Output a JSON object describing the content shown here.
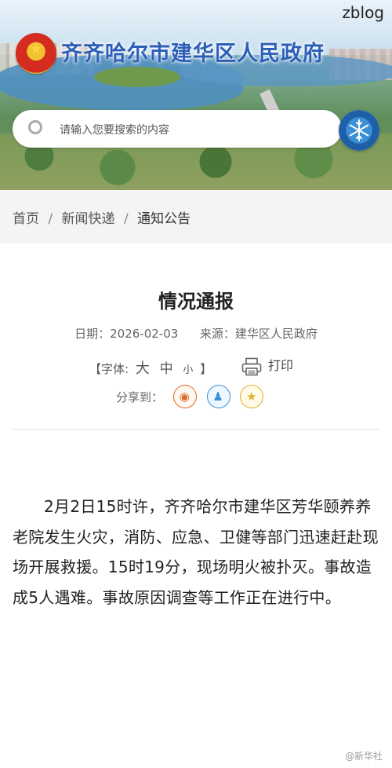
{
  "watermark": "zblog",
  "header": {
    "site_title": "齐齐哈尔市建华区人民政府",
    "search": {
      "placeholder": "请输入您要搜索的内容"
    }
  },
  "breadcrumb": {
    "items": [
      "首页",
      "新闻快递",
      "通知公告"
    ],
    "separator": "/"
  },
  "article": {
    "title": "情况通报",
    "date_label": "日期：",
    "date": "2026-02-03",
    "source_label": "来源：",
    "source": "建华区人民政府",
    "font_label_open": "【字体:",
    "font_large": "大",
    "font_medium": "中",
    "font_small": "小",
    "font_label_close": "】",
    "print_label": "打印",
    "share_label": "分享到：",
    "share_targets": [
      "weibo-icon",
      "qq-icon",
      "qzone-icon"
    ],
    "body": "2月2日15时许，齐齐哈尔市建华区芳华颐养养老院发生火灾，消防、应急、卫健等部门迅速赶赴现场开展救援。15时19分，现场明火被扑灭。事故造成5人遇难。事故原因调查等工作正在进行中。"
  },
  "footer_mark": "@新华社",
  "colors": {
    "title_blue": "#2c5fb8",
    "breadcrumb_bg": "#f4f4f4",
    "weibo": "#e06a2c",
    "qq": "#3a8fd6",
    "qzone": "#e0b22a"
  }
}
